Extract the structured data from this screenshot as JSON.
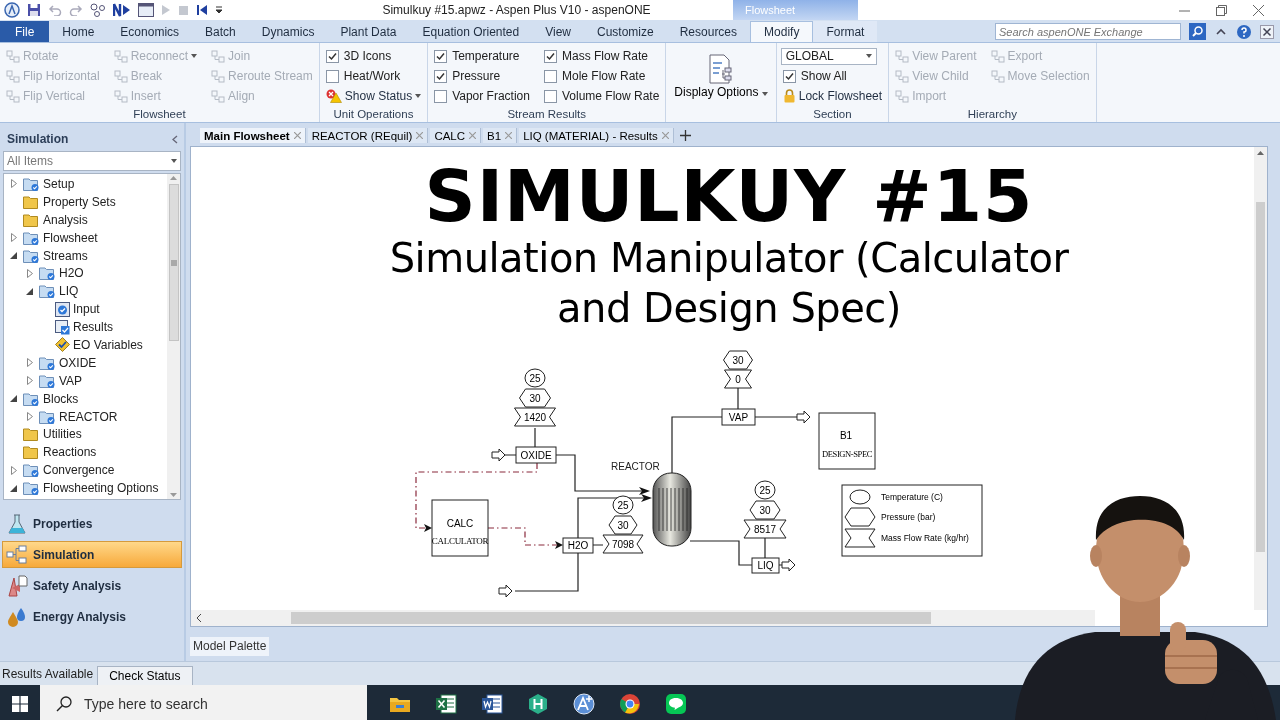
{
  "window": {
    "title": "Simulkuy #15.apwz - Aspen Plus V10 - aspenONE",
    "context_tab": "Flowsheet"
  },
  "menu_tabs": [
    {
      "label": "File",
      "kind": "file",
      "selected": false
    },
    {
      "label": "Home",
      "kind": "tab",
      "selected": false
    },
    {
      "label": "Economics",
      "kind": "tab",
      "selected": false
    },
    {
      "label": "Batch",
      "kind": "tab",
      "selected": false
    },
    {
      "label": "Dynamics",
      "kind": "tab",
      "selected": false
    },
    {
      "label": "Plant Data",
      "kind": "tab",
      "selected": false
    },
    {
      "label": "Equation Oriented",
      "kind": "tab",
      "selected": false
    },
    {
      "label": "View",
      "kind": "tab",
      "selected": false
    },
    {
      "label": "Customize",
      "kind": "tab",
      "selected": false
    },
    {
      "label": "Resources",
      "kind": "tab",
      "selected": false
    },
    {
      "label": "Modify",
      "kind": "context",
      "selected": true
    },
    {
      "label": "Format",
      "kind": "context",
      "selected": false
    }
  ],
  "search": {
    "placeholder": "Search aspenONE Exchange"
  },
  "ribbon": {
    "groups": [
      {
        "title": "Flowsheet",
        "items": [
          {
            "kind": "tool",
            "label": "Rotate",
            "disabled": true
          },
          {
            "kind": "tool",
            "label": "Flip Horizontal",
            "disabled": true
          },
          {
            "kind": "tool",
            "label": "Flip Vertical",
            "disabled": true
          },
          {
            "kind": "tool",
            "label": "Reconnect",
            "disabled": true,
            "menu": true
          },
          {
            "kind": "tool",
            "label": "Break",
            "disabled": true
          },
          {
            "kind": "tool",
            "label": "Insert",
            "disabled": true
          },
          {
            "kind": "tool",
            "label": "Join",
            "disabled": true
          },
          {
            "kind": "tool",
            "label": "Reroute Stream",
            "disabled": true
          },
          {
            "kind": "tool",
            "label": "Align",
            "disabled": true
          }
        ]
      },
      {
        "title": "Unit Operations",
        "items": [
          {
            "kind": "check",
            "label": "3D Icons",
            "checked": true
          },
          {
            "kind": "check",
            "label": "Heat/Work",
            "checked": false
          },
          {
            "kind": "tool",
            "label": "Show Status",
            "disabled": false,
            "menu": true
          }
        ]
      },
      {
        "title": "Stream Results",
        "items": [
          {
            "kind": "check",
            "label": "Temperature",
            "checked": true
          },
          {
            "kind": "check",
            "label": "Pressure",
            "checked": true
          },
          {
            "kind": "check",
            "label": "Vapor Fraction",
            "checked": false
          },
          {
            "kind": "check",
            "label": "Mass Flow Rate",
            "checked": true
          },
          {
            "kind": "check",
            "label": "Mole Flow Rate",
            "checked": false
          },
          {
            "kind": "check",
            "label": "Volume Flow Rate",
            "checked": false
          }
        ]
      },
      {
        "items": [
          {
            "kind": "large",
            "label": "Display Options",
            "menu": true
          }
        ]
      },
      {
        "title": "Section",
        "items": [
          {
            "kind": "select",
            "value": "GLOBAL"
          },
          {
            "kind": "check",
            "label": "Show All",
            "checked": true
          },
          {
            "kind": "tool",
            "label": "Lock Flowsheet",
            "disabled": false
          }
        ]
      },
      {
        "title": "Hierarchy",
        "items": [
          {
            "kind": "tool",
            "label": "View Parent",
            "disabled": true
          },
          {
            "kind": "tool",
            "label": "View Child",
            "disabled": true
          },
          {
            "kind": "tool",
            "label": "Import",
            "disabled": true
          },
          {
            "kind": "tool",
            "label": "Export",
            "disabled": true
          },
          {
            "kind": "tool",
            "label": "Move Selection",
            "disabled": true
          }
        ]
      }
    ]
  },
  "sidebar": {
    "title": "Simulation",
    "filter": "All Items",
    "tree": [
      {
        "label": "Setup",
        "expanded": false
      },
      {
        "label": "Property Sets"
      },
      {
        "label": "Analysis"
      },
      {
        "label": "Flowsheet",
        "expanded": false
      },
      {
        "label": "Streams",
        "expanded": true,
        "children": [
          {
            "label": "H2O",
            "expanded": false
          },
          {
            "label": "LIQ",
            "expanded": true,
            "children": [
              {
                "label": "Input",
                "kind": "form"
              },
              {
                "label": "Results",
                "kind": "results"
              },
              {
                "label": "EO Variables",
                "kind": "variables"
              }
            ]
          },
          {
            "label": "OXIDE",
            "expanded": false
          },
          {
            "label": "VAP",
            "expanded": false
          }
        ]
      },
      {
        "label": "Blocks",
        "expanded": true,
        "children": [
          {
            "label": "REACTOR",
            "expanded": false
          }
        ]
      },
      {
        "label": "Utilities"
      },
      {
        "label": "Reactions"
      },
      {
        "label": "Convergence",
        "expanded": false
      },
      {
        "label": "Flowsheeting Options",
        "expanded": true
      }
    ],
    "nav": [
      {
        "label": "Properties",
        "selected": false
      },
      {
        "label": "Simulation",
        "selected": true
      },
      {
        "label": "Safety Analysis",
        "selected": false
      },
      {
        "label": "Energy Analysis",
        "selected": false
      }
    ]
  },
  "doc_tabs": [
    {
      "label": "Main Flowsheet",
      "selected": true
    },
    {
      "label": "REACTOR (REquil)",
      "selected": false
    },
    {
      "label": "CALC",
      "selected": false
    },
    {
      "label": "B1",
      "selected": false
    },
    {
      "label": "LIQ (MATERIAL) - Results",
      "selected": false
    }
  ],
  "canvas": {
    "title": "SIMULKUY #15",
    "subtitle": "Simulation Manipulator (Calculator and Design Spec)",
    "flowsheet": {
      "reactor": "REACTOR",
      "streams": [
        {
          "label": "OXIDE",
          "temperature": "25",
          "pressure": "30",
          "mass_flow": "1420"
        },
        {
          "label": "H2O",
          "temperature": "25",
          "pressure": "30",
          "mass_flow": "7098"
        },
        {
          "label": "VAP",
          "pressure": "30",
          "mass_flow": "0"
        },
        {
          "label": "LIQ",
          "temperature": "25",
          "pressure": "30",
          "mass_flow": "8517"
        }
      ],
      "calculator": {
        "name": "CALC",
        "type": "CALCULATOR"
      },
      "design_spec": {
        "name": "B1",
        "type": "DESIGN-SPEC"
      },
      "legend": [
        "Temperature (C)",
        "Pressure (bar)",
        "Mass Flow Rate (kg/hr)"
      ]
    }
  },
  "palette_tab": "Model Palette",
  "status_bar": {
    "message": "Results Available",
    "button": "Check Status"
  },
  "taskbar": {
    "search_placeholder": "Type here to search"
  }
}
